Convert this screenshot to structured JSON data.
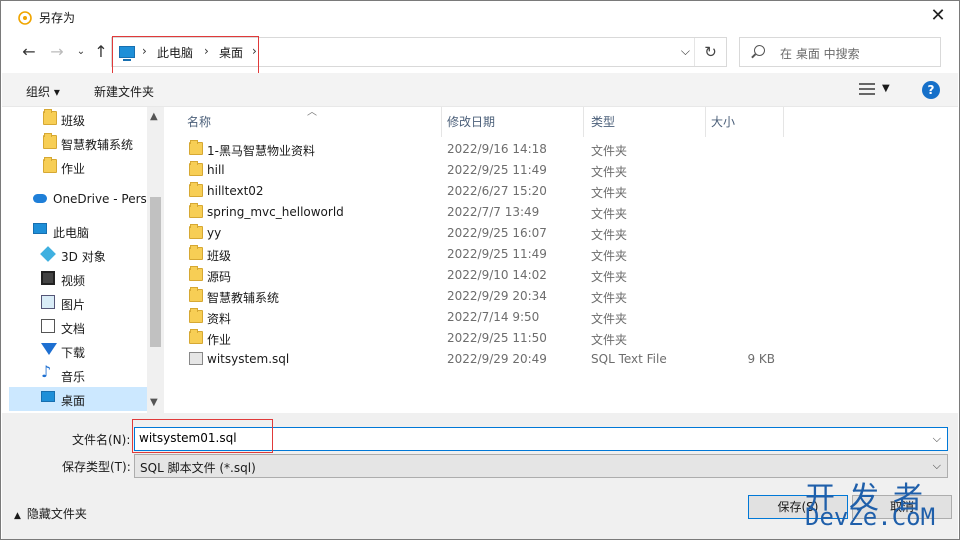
{
  "window": {
    "title": "另存为"
  },
  "address": {
    "crumbs": [
      "此电脑",
      "桌面"
    ],
    "search_placeholder": "在 桌面 中搜索"
  },
  "toolbar": {
    "organize": "组织 ▾",
    "new_folder": "新建文件夹"
  },
  "nav": {
    "items": [
      {
        "label": "班级",
        "icon": "folder-icon"
      },
      {
        "label": "智慧教辅系统",
        "icon": "folder-icon"
      },
      {
        "label": "作业",
        "icon": "folder-icon"
      },
      {
        "label": "OneDrive - Pers",
        "icon": "onedrive-icon"
      },
      {
        "label": "此电脑",
        "icon": "computer-icon"
      },
      {
        "label": "3D 对象",
        "icon": "3d-objects-icon"
      },
      {
        "label": "视频",
        "icon": "video-icon"
      },
      {
        "label": "图片",
        "icon": "pictures-icon"
      },
      {
        "label": "文档",
        "icon": "documents-icon"
      },
      {
        "label": "下载",
        "icon": "downloads-icon"
      },
      {
        "label": "音乐",
        "icon": "music-icon"
      },
      {
        "label": "桌面",
        "icon": "desktop-icon",
        "selected": true
      }
    ]
  },
  "columns": {
    "name": "名称",
    "date": "修改日期",
    "type": "类型",
    "size": "大小"
  },
  "files": [
    {
      "name": "1-黑马智慧物业资料",
      "date": "2022/9/16 14:18",
      "type": "文件夹",
      "size": ""
    },
    {
      "name": "hill",
      "date": "2022/9/25 11:49",
      "type": "文件夹",
      "size": ""
    },
    {
      "name": "hilltext02",
      "date": "2022/6/27 15:20",
      "type": "文件夹",
      "size": ""
    },
    {
      "name": "spring_mvc_helloworld",
      "date": "2022/7/7 13:49",
      "type": "文件夹",
      "size": ""
    },
    {
      "name": "yy",
      "date": "2022/9/25 16:07",
      "type": "文件夹",
      "size": ""
    },
    {
      "name": "班级",
      "date": "2022/9/25 11:49",
      "type": "文件夹",
      "size": ""
    },
    {
      "name": "源码",
      "date": "2022/9/10 14:02",
      "type": "文件夹",
      "size": ""
    },
    {
      "name": "智慧教辅系统",
      "date": "2022/9/29 20:34",
      "type": "文件夹",
      "size": ""
    },
    {
      "name": "资料",
      "date": "2022/7/14 9:50",
      "type": "文件夹",
      "size": ""
    },
    {
      "name": "作业",
      "date": "2022/9/25 11:50",
      "type": "文件夹",
      "size": ""
    },
    {
      "name": "witsystem.sql",
      "date": "2022/9/29 20:49",
      "type": "SQL Text File",
      "size": "9 KB"
    }
  ],
  "form": {
    "filename_label": "文件名(N):",
    "filename_value": "witsystem01.sql",
    "filetype_label": "保存类型(T):",
    "filetype_value": "SQL 脚本文件 (*.sql)",
    "hide_folders": "隐藏文件夹",
    "save": "保存(S)",
    "cancel": "取消"
  },
  "watermark": {
    "line1": "开发者",
    "line2": "DevZe.CoM"
  },
  "colors": {
    "accent": "#0078d7",
    "highlight": "#e03a3a",
    "selection": "#cce8ff"
  }
}
